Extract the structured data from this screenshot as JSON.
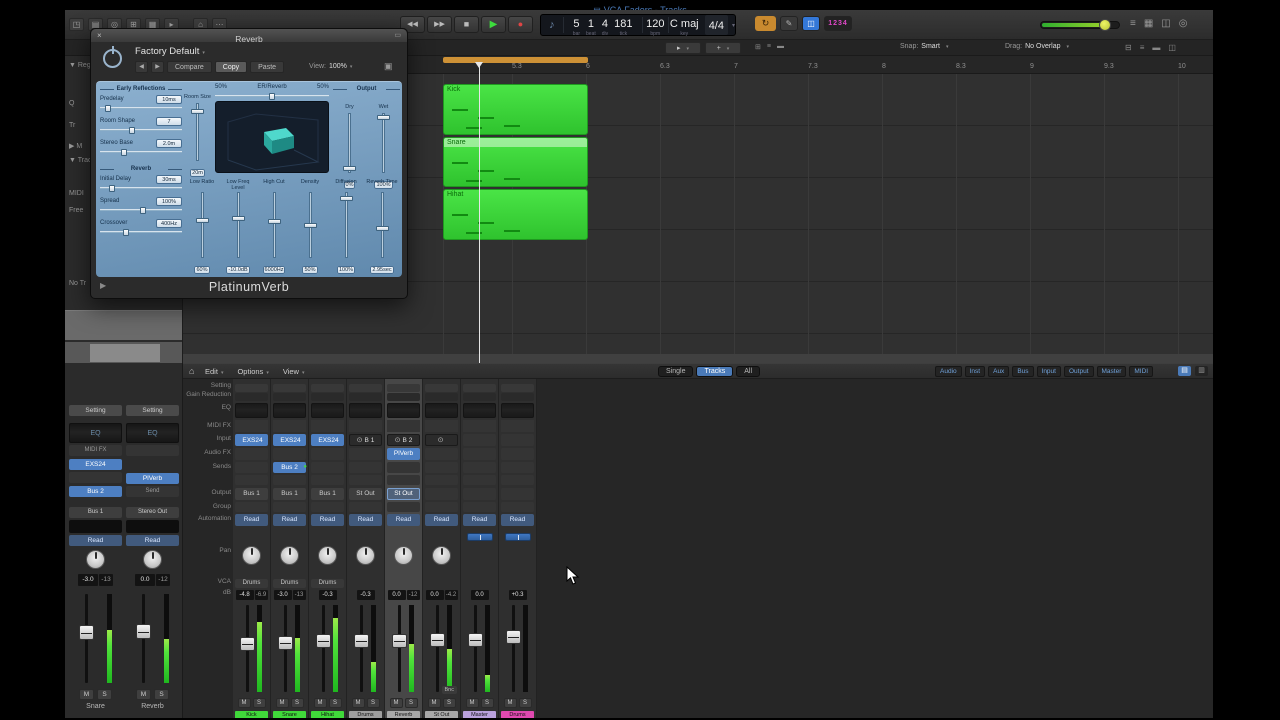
{
  "window": {
    "title": "VCA Faders - Tracks",
    "doc_icon": "▤"
  },
  "toolbar": {
    "left_icons": [
      "◳",
      "▤",
      "◎",
      "⊞",
      "▦",
      "▸"
    ],
    "left_icons2": [
      "⌂",
      "⋯"
    ],
    "transport": {
      "rewind": "◀◀",
      "forward": "▶▶",
      "stop": "■",
      "play": "▶",
      "record": "●"
    },
    "cycle_icon": "↻",
    "pencil_icon": "✎",
    "blue_icon": "◫",
    "counter": "1234",
    "volume": 0.85,
    "far_icons": [
      "≡",
      "▦",
      "◫",
      "◎"
    ]
  },
  "lcd": {
    "note_icon": "♪",
    "bar": "5",
    "beat": "1",
    "div": "4",
    "tick": "181",
    "pos_labels": [
      "bar",
      "beat",
      "div",
      "tick"
    ],
    "tempo": "120",
    "tempo_label": "bpm",
    "key": "C maj",
    "key_label": "key",
    "sig": "4/4",
    "dropdown": "▾"
  },
  "controlbar": {
    "tool1": "▸",
    "tool2": "+",
    "icons": [
      "⊞",
      "≡",
      "▬"
    ],
    "snap_label": "Snap:",
    "snap_value": "Smart",
    "drag_label": "Drag:",
    "drag_value": "No Overlap",
    "right_icons": [
      "⊟",
      "≡",
      "▬",
      "◫"
    ]
  },
  "ruler": {
    "ticks": [
      "5.3",
      "6",
      "6.3",
      "7",
      "7.3",
      "8",
      "8.3",
      "9",
      "9.3",
      "10"
    ]
  },
  "regions": [
    {
      "name": "Kick"
    },
    {
      "name": "Snare"
    },
    {
      "name": "Hihat"
    }
  ],
  "inspector": {
    "items": [
      "▼ Reg",
      "Q",
      "Tr",
      "▶ M",
      "▼ Track",
      "MIDI",
      "Free",
      "No Tr"
    ]
  },
  "plugin": {
    "title": "Reverb",
    "close": "×",
    "mini": "▭",
    "preset": "Factory Default",
    "nav_back": "◀",
    "nav_fwd": "▶",
    "compare": "Compare",
    "copy": "Copy",
    "paste": "Paste",
    "view_label": "View:",
    "view_value": "100%",
    "link_icon": "▣",
    "early_label": "Early Reflections",
    "early_params": [
      {
        "label": "Predelay",
        "value": "10ms",
        "pos": 0.07
      },
      {
        "label": "Room Shape",
        "value": "7",
        "pos": 0.38
      },
      {
        "label": "Stereo Base",
        "value": "2.0m",
        "pos": 0.27
      }
    ],
    "reverb_label": "Reverb",
    "reverb_params": [
      {
        "label": "Initial Delay",
        "value": "30ms",
        "pos": 0.12
      },
      {
        "label": "Spread",
        "value": "100%",
        "pos": 0.52
      },
      {
        "label": "Crossover",
        "value": "400Hz",
        "pos": 0.3
      }
    ],
    "room_size": {
      "label": "Room Size",
      "value": "20m",
      "pos": 0.88
    },
    "balance": {
      "left": "50%",
      "center": "ER/Reverb",
      "right": "50%",
      "pos": 0.5
    },
    "output_label": "Output",
    "output_sliders": [
      {
        "label": "Dry",
        "value": "0%",
        "pos": 0.03
      },
      {
        "label": "Wet",
        "value": "100%",
        "pos": 0.96
      }
    ],
    "bottom_sliders": [
      {
        "label": "Low Ratio",
        "value": "60%",
        "pos": 0.58
      },
      {
        "label": "Low Freq Level",
        "value": "-10.0dB",
        "pos": 0.6
      },
      {
        "label": "High Cut",
        "value": "6000Hz",
        "pos": 0.55
      },
      {
        "label": "Density",
        "value": "50%",
        "pos": 0.5
      },
      {
        "label": "Diffusion",
        "value": "100%",
        "pos": 0.93
      },
      {
        "label": "Reverb Time",
        "value": "2.95sec",
        "pos": 0.44
      }
    ],
    "name": "PlatinumVerb",
    "disclosure": "▶"
  },
  "mixer": {
    "home_icon": "⌂",
    "menus": [
      "Edit",
      "Options",
      "View"
    ],
    "view_buttons": [
      {
        "label": "Single",
        "state": ""
      },
      {
        "label": "Tracks",
        "state": "active"
      },
      {
        "label": "All",
        "state": ""
      }
    ],
    "filters": [
      "Audio",
      "Inst",
      "Aux",
      "Bus",
      "Input",
      "Output",
      "Master",
      "MIDI"
    ],
    "view_icons": [
      "▤",
      "▥"
    ],
    "row_labels": [
      "Setting",
      "Gain Reduction",
      "EQ",
      "MIDI FX",
      "Input",
      "Audio FX",
      "Sends",
      "Output",
      "Group",
      "Automation",
      "Pan",
      "VCA",
      "dB"
    ],
    "ms": {
      "m": "M",
      "s": "S"
    },
    "channels": [
      {
        "state": "",
        "input_kind": "inst",
        "input_icon": "",
        "input": "EXS24",
        "fx": "",
        "sends": "",
        "send_dot": "",
        "output": "Bus 1",
        "out_state": "",
        "auto": "Read",
        "pan": "knob",
        "vca": "Drums",
        "db": "-4.8",
        "peak": "-6.9",
        "bnc": "",
        "name": "Kick",
        "color": "#40d83a",
        "fader": 0.56,
        "meter": 0.8
      },
      {
        "state": "",
        "input_kind": "inst",
        "input_icon": "",
        "input": "EXS24",
        "fx": "",
        "sends": "Bus 2",
        "send_dot": "●",
        "output": "Bus 1",
        "out_state": "",
        "auto": "Read",
        "pan": "knob",
        "vca": "Drums",
        "db": "-3.0",
        "peak": "-13",
        "bnc": "",
        "name": "Snare",
        "color": "#40d83a",
        "fader": 0.58,
        "meter": 0.62
      },
      {
        "state": "",
        "input_kind": "inst",
        "input_icon": "",
        "input": "EXS24",
        "fx": "",
        "sends": "",
        "send_dot": "",
        "output": "Bus 1",
        "out_state": "",
        "auto": "Read",
        "pan": "knob",
        "vca": "Drums",
        "db": "-0.3",
        "peak": "",
        "bnc": "",
        "name": "Hihat",
        "color": "#40d83a",
        "fader": 0.6,
        "meter": 0.85
      },
      {
        "state": "",
        "input_kind": "bus",
        "input_icon": "⊙",
        "input": "B 1",
        "fx": "",
        "sends": "",
        "send_dot": "",
        "output": "St Out",
        "out_state": "",
        "auto": "Read",
        "pan": "knob",
        "vca": "",
        "db": "-0.3",
        "peak": "",
        "bnc": "",
        "name": "Drums",
        "color": "#9e9e9e",
        "fader": 0.6,
        "meter": 0.35
      },
      {
        "state": "selected",
        "input_kind": "bus",
        "input_icon": "⊙",
        "input": "B 2",
        "fx": "PlVerb",
        "sends": "",
        "send_dot": "",
        "output": "St Out",
        "out_state": "hl",
        "auto": "Read",
        "pan": "knob",
        "vca": "",
        "db": "0.0",
        "peak": "-12",
        "bnc": "",
        "name": "Reverb",
        "color": "#a8a8a8",
        "fader": 0.6,
        "meter": 0.55
      },
      {
        "state": "",
        "input_kind": "out",
        "input_icon": "⊙",
        "input": "",
        "fx": "",
        "sends": "",
        "send_dot": "",
        "output": "",
        "out_state": "",
        "auto": "Read",
        "pan": "knob",
        "vca": "",
        "db": "0.0",
        "peak": "-4.2",
        "bnc": "Bnc",
        "name": "St Out",
        "color": "#a8a8a8",
        "fader": 0.62,
        "meter": 0.5
      },
      {
        "state": "",
        "input_kind": "",
        "input_icon": "",
        "input": "",
        "fx": "",
        "sends": "",
        "send_dot": "",
        "output": "",
        "out_state": "",
        "auto": "Read",
        "pan": "bal",
        "vca": "",
        "db": "0.0",
        "peak": "",
        "bnc": "",
        "name": "Master",
        "color": "#b9a1dc",
        "fader": 0.62,
        "meter": 0.2
      },
      {
        "state": "",
        "input_kind": "",
        "input_icon": "",
        "input": "",
        "fx": "",
        "sends": "",
        "send_dot": "",
        "output": "",
        "out_state": "",
        "auto": "Read",
        "pan": "bal",
        "vca": "",
        "db": "+0.3",
        "peak": "",
        "bnc": "",
        "name": "Drums",
        "color": "#e049b0",
        "fader": 0.66,
        "meter": 0
      }
    ]
  },
  "strips": {
    "a": {
      "setting": "Setting",
      "eq": "EQ",
      "midifx": "MIDI FX",
      "inst": "EXS24",
      "fx": "",
      "send": "Bus 2",
      "output": "Bus 1",
      "auto": "Read",
      "db": "-3.0",
      "peak": "-13",
      "name": "Snare",
      "fader": 0.58,
      "meter": 0.6
    },
    "b": {
      "setting": "Setting",
      "eq": "EQ",
      "midifx": "",
      "inst": "",
      "fx": "PlVerb",
      "send": "Send",
      "output": "Stereo Out",
      "auto": "Read",
      "db": "0.0",
      "peak": "-12",
      "name": "Reverb",
      "fader": 0.6,
      "meter": 0.5
    }
  }
}
